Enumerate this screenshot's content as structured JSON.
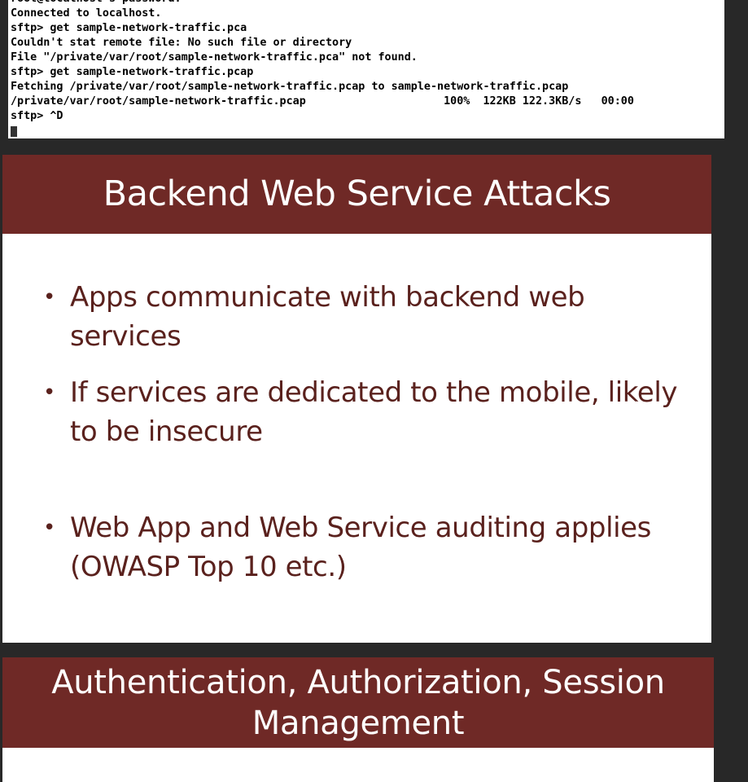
{
  "terminal": {
    "lines": [
      "root@localhost's password:",
      "Connected to localhost.",
      "sftp> get sample-network-traffic.pca",
      "Couldn't stat remote file: No such file or directory",
      "File \"/private/var/root/sample-network-traffic.pca\" not found.",
      "sftp> get sample-network-traffic.pcap",
      "Fetching /private/var/root/sample-network-traffic.pcap to sample-network-traffic.pcap",
      "/private/var/root/sample-network-traffic.pcap                     100%  122KB 122.3KB/s   00:00",
      "sftp> ^D"
    ]
  },
  "slide1": {
    "title": "Backend Web Service Attacks",
    "bullets": [
      "Apps communicate with backend web services",
      "If services are dedicated to the mobile, likely to be insecure",
      "Web App and Web Service auditing applies (OWASP Top 10 etc.)"
    ],
    "bullet_symbol": "•"
  },
  "slide2": {
    "title_line1": "Authentication, Authorization, Session",
    "title_line2": "Management"
  },
  "colors": {
    "header_bg": "#6f2926",
    "bullet_text": "#5a211d",
    "page_bg": "#282828"
  }
}
